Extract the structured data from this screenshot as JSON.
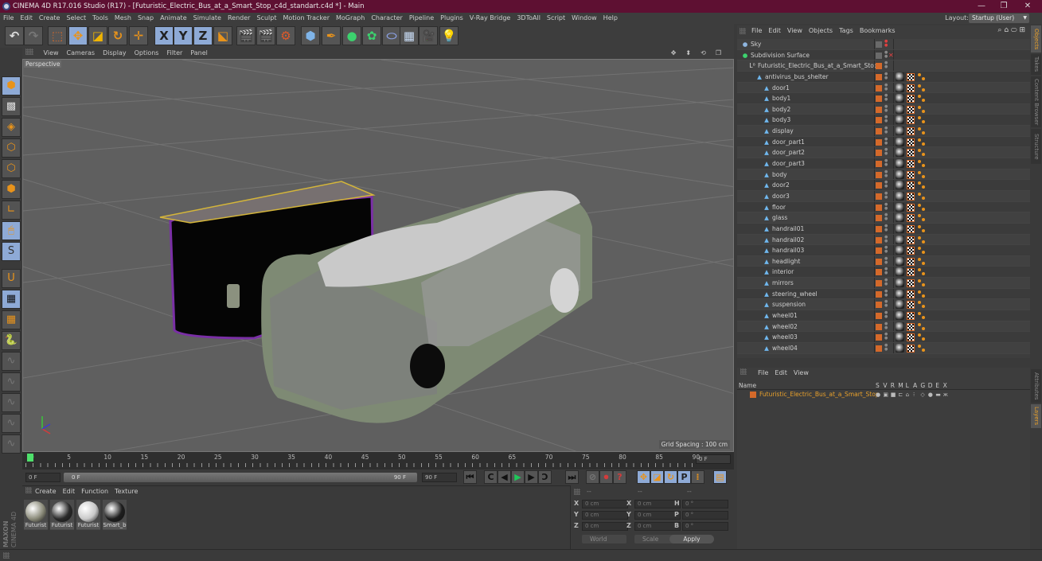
{
  "window": {
    "title": "CINEMA 4D R17.016 Studio (R17) - [Futuristic_Electric_Bus_at_a_Smart_Stop_c4d_standart.c4d *] - Main",
    "controls": [
      "—",
      "❐",
      "✕"
    ]
  },
  "menubar": {
    "items": [
      "File",
      "Edit",
      "Create",
      "Select",
      "Tools",
      "Mesh",
      "Snap",
      "Animate",
      "Simulate",
      "Render",
      "Sculpt",
      "Motion Tracker",
      "MoGraph",
      "Character",
      "Pipeline",
      "Plugins",
      "V-Ray Bridge",
      "3DToAll",
      "Script",
      "Window",
      "Help"
    ],
    "layout_label": "Layout:",
    "layout_value": "Startup (User)"
  },
  "toolbar": {
    "buttons": [
      {
        "name": "undo-icon",
        "glyph": "↶"
      },
      {
        "name": "redo-icon",
        "glyph": "↷"
      },
      {
        "name": "live-selection-icon",
        "glyph": "⬚"
      },
      {
        "name": "move-icon",
        "glyph": "✥"
      },
      {
        "name": "scale-icon",
        "glyph": "◪"
      },
      {
        "name": "rotate-icon",
        "glyph": "↻"
      },
      {
        "name": "last-tool-icon",
        "glyph": "✛"
      },
      {
        "name": "x-axis-icon",
        "glyph": "X"
      },
      {
        "name": "y-axis-icon",
        "glyph": "Y"
      },
      {
        "name": "z-axis-icon",
        "glyph": "Z"
      },
      {
        "name": "coordinate-system-icon",
        "glyph": "⬕"
      },
      {
        "name": "render-view-icon",
        "glyph": "🎬"
      },
      {
        "name": "render-picture-viewer-icon",
        "glyph": "🎬"
      },
      {
        "name": "render-settings-icon",
        "glyph": "⚙"
      },
      {
        "name": "cube-icon",
        "glyph": "⬢"
      },
      {
        "name": "pen-icon",
        "glyph": "✒"
      },
      {
        "name": "subdivision-icon",
        "glyph": "●"
      },
      {
        "name": "cloner-icon",
        "glyph": "✿"
      },
      {
        "name": "deformer-icon",
        "glyph": "⬭"
      },
      {
        "name": "floor-icon",
        "glyph": "▦"
      },
      {
        "name": "camera-icon",
        "glyph": "🎥"
      },
      {
        "name": "light-icon",
        "glyph": "💡"
      }
    ]
  },
  "left_tools": [
    {
      "name": "model-mode-icon",
      "glyph": "⬢"
    },
    {
      "name": "texture-mode-icon",
      "glyph": "▩"
    },
    {
      "name": "workplane-icon",
      "glyph": "◈"
    },
    {
      "name": "points-mode-icon",
      "glyph": "⬡"
    },
    {
      "name": "edges-mode-icon",
      "glyph": "⬡"
    },
    {
      "name": "polygons-mode-icon",
      "glyph": "⬢"
    },
    {
      "name": "axis-mode-icon",
      "glyph": "∟"
    },
    {
      "name": "tweak-mode-icon",
      "glyph": "🖱"
    },
    {
      "name": "solo-icon",
      "glyph": "S"
    },
    {
      "name": "snap-icon",
      "glyph": "U"
    },
    {
      "name": "lock-workplane-icon",
      "glyph": "▦"
    },
    {
      "name": "planar-workplane-icon",
      "glyph": "▦"
    },
    {
      "name": "python-icon",
      "glyph": "🐍"
    },
    {
      "name": "spline-tool-1-icon",
      "glyph": "∿"
    },
    {
      "name": "spline-tool-2-icon",
      "glyph": "∿"
    },
    {
      "name": "spline-tool-3-icon",
      "glyph": "∿"
    },
    {
      "name": "spline-tool-4-icon",
      "glyph": "∿"
    },
    {
      "name": "spline-tool-5-icon",
      "glyph": "∿"
    }
  ],
  "viewport": {
    "menu": [
      "View",
      "Cameras",
      "Display",
      "Options",
      "Filter",
      "Panel"
    ],
    "label": "Perspective",
    "grid_spacing": "Grid Spacing : 100 cm",
    "nav_icons": [
      "✥",
      "⬍",
      "⟲",
      "❐"
    ]
  },
  "timeline": {
    "ticks": [
      "0",
      "5",
      "10",
      "15",
      "20",
      "25",
      "30",
      "35",
      "40",
      "45",
      "50",
      "55",
      "60",
      "65",
      "70",
      "75",
      "80",
      "85",
      "90"
    ],
    "current_frame_field": "0 F",
    "start_field": "0 F",
    "slider_start": "0 F",
    "slider_end": "90 F",
    "end_field": "90 F",
    "playback_position": 0
  },
  "transport": {
    "buttons": [
      {
        "name": "go-to-start-icon",
        "glyph": "⏮"
      },
      {
        "name": "prev-key-icon",
        "glyph": "C"
      },
      {
        "name": "prev-frame-icon",
        "glyph": "◀"
      },
      {
        "name": "play-icon",
        "glyph": "▶"
      },
      {
        "name": "next-frame-icon",
        "glyph": "▶"
      },
      {
        "name": "next-key-icon",
        "glyph": "Ɔ"
      },
      {
        "name": "go-to-end-icon",
        "glyph": "⏭"
      },
      {
        "name": "record-disabled-icon",
        "glyph": "⊘"
      },
      {
        "name": "autokey-icon",
        "glyph": "⏺"
      },
      {
        "name": "keyframe-selection-icon",
        "glyph": "?"
      },
      {
        "name": "key-position-icon",
        "glyph": "✥"
      },
      {
        "name": "key-scale-icon",
        "glyph": "◪"
      },
      {
        "name": "key-rotation-icon",
        "glyph": "↻"
      },
      {
        "name": "key-parameter-icon",
        "glyph": "P"
      },
      {
        "name": "key-pla-icon",
        "glyph": "⁞"
      },
      {
        "name": "timeline-icon",
        "glyph": "▤"
      }
    ]
  },
  "material_manager": {
    "menu": [
      "Create",
      "Edit",
      "Function",
      "Texture"
    ],
    "materials": [
      {
        "label": "Futurist",
        "swatch": "#8b8b7a"
      },
      {
        "label": "Futurist",
        "swatch": "#2a2a2a"
      },
      {
        "label": "Futurist",
        "swatch": "#c9c9c9"
      },
      {
        "label": "Smart_b",
        "swatch": "#1e1e1e"
      }
    ],
    "brand_line1": "MAXON",
    "brand_line2": "CINEMA 4D"
  },
  "coordinates": {
    "headers": [
      "--",
      "--",
      "--"
    ],
    "rows": [
      {
        "l1": "X",
        "v1": "0 cm",
        "l2": "X",
        "v2": "0 cm",
        "l3": "H",
        "v3": "0 °"
      },
      {
        "l1": "Y",
        "v1": "0 cm",
        "l2": "Y",
        "v2": "0 cm",
        "l3": "P",
        "v3": "0 °"
      },
      {
        "l1": "Z",
        "v1": "0 cm",
        "l2": "Z",
        "v2": "0 cm",
        "l3": "B",
        "v3": "0 °"
      }
    ],
    "mode_dropdown": "World",
    "transform_dropdown": "Scale",
    "apply_label": "Apply"
  },
  "object_manager": {
    "menu": [
      "File",
      "Edit",
      "View",
      "Objects",
      "Tags",
      "Bookmarks"
    ],
    "objects": [
      {
        "name": "Sky",
        "depth": 0,
        "icon": "sky",
        "swatch": "gray",
        "tags": false
      },
      {
        "name": "Subdivision Surface",
        "depth": 0,
        "icon": "subdiv",
        "swatch": "gray",
        "tags": false,
        "x": true
      },
      {
        "name": "Futuristic_Electric_Bus_at_a_Smart_Stop",
        "depth": 1,
        "icon": "null",
        "swatch": "orange",
        "tags": false
      },
      {
        "name": "antivirus_bus_shelter",
        "depth": 2,
        "icon": "poly",
        "swatch": "orange",
        "tags": true
      },
      {
        "name": "door1",
        "depth": 3,
        "icon": "poly",
        "swatch": "orange",
        "tags": true
      },
      {
        "name": "body1",
        "depth": 3,
        "icon": "poly",
        "swatch": "orange",
        "tags": true
      },
      {
        "name": "body2",
        "depth": 3,
        "icon": "poly",
        "swatch": "orange",
        "tags": true
      },
      {
        "name": "body3",
        "depth": 3,
        "icon": "poly",
        "swatch": "orange",
        "tags": true
      },
      {
        "name": "display",
        "depth": 3,
        "icon": "poly",
        "swatch": "orange",
        "tags": true
      },
      {
        "name": "door_part1",
        "depth": 3,
        "icon": "poly",
        "swatch": "orange",
        "tags": true
      },
      {
        "name": "door_part2",
        "depth": 3,
        "icon": "poly",
        "swatch": "orange",
        "tags": true
      },
      {
        "name": "door_part3",
        "depth": 3,
        "icon": "poly",
        "swatch": "orange",
        "tags": true
      },
      {
        "name": "body",
        "depth": 3,
        "icon": "poly",
        "swatch": "orange",
        "tags": true
      },
      {
        "name": "door2",
        "depth": 3,
        "icon": "poly",
        "swatch": "orange",
        "tags": true
      },
      {
        "name": "door3",
        "depth": 3,
        "icon": "poly",
        "swatch": "orange",
        "tags": true
      },
      {
        "name": "floor",
        "depth": 3,
        "icon": "poly",
        "swatch": "orange",
        "tags": true
      },
      {
        "name": "glass",
        "depth": 3,
        "icon": "poly",
        "swatch": "orange",
        "tags": true
      },
      {
        "name": "handrail01",
        "depth": 3,
        "icon": "poly",
        "swatch": "orange",
        "tags": true
      },
      {
        "name": "handrail02",
        "depth": 3,
        "icon": "poly",
        "swatch": "orange",
        "tags": true
      },
      {
        "name": "handrail03",
        "depth": 3,
        "icon": "poly",
        "swatch": "orange",
        "tags": true
      },
      {
        "name": "headlight",
        "depth": 3,
        "icon": "poly",
        "swatch": "orange",
        "tags": true
      },
      {
        "name": "interior",
        "depth": 3,
        "icon": "poly",
        "swatch": "orange",
        "tags": true
      },
      {
        "name": "mirrors",
        "depth": 3,
        "icon": "poly",
        "swatch": "orange",
        "tags": true
      },
      {
        "name": "steering_wheel",
        "depth": 3,
        "icon": "poly",
        "swatch": "orange",
        "tags": true
      },
      {
        "name": "suspension",
        "depth": 3,
        "icon": "poly",
        "swatch": "orange",
        "tags": true
      },
      {
        "name": "wheel01",
        "depth": 3,
        "icon": "poly",
        "swatch": "orange",
        "tags": true
      },
      {
        "name": "wheel02",
        "depth": 3,
        "icon": "poly",
        "swatch": "orange",
        "tags": true
      },
      {
        "name": "wheel03",
        "depth": 3,
        "icon": "poly",
        "swatch": "orange",
        "tags": true
      },
      {
        "name": "wheel04",
        "depth": 3,
        "icon": "poly",
        "swatch": "orange",
        "tags": true
      }
    ]
  },
  "layer_manager": {
    "menu": [
      "File",
      "Edit",
      "View"
    ],
    "name_header": "Name",
    "columns": [
      "S",
      "V",
      "R",
      "M",
      "L",
      "A",
      "G",
      "D",
      "E",
      "X"
    ],
    "layers": [
      {
        "name": "Futuristic_Electric_Bus_at_a_Smart_Stop",
        "color": "#d4692a"
      }
    ]
  },
  "right_tabs": {
    "top": [
      {
        "label": "Objects",
        "active": true
      },
      {
        "label": "Takes",
        "active": false
      },
      {
        "label": "Content Browser",
        "active": false
      },
      {
        "label": "Structure",
        "active": false
      }
    ],
    "bottom": [
      {
        "label": "Attributes",
        "active": false
      },
      {
        "label": "Layers",
        "active": true
      }
    ]
  },
  "colors": {
    "title_bar": "#5e1032",
    "accent_orange": "#e8a02b",
    "selection_blue": "#8eaad6",
    "layer_orange": "#d4692a"
  }
}
